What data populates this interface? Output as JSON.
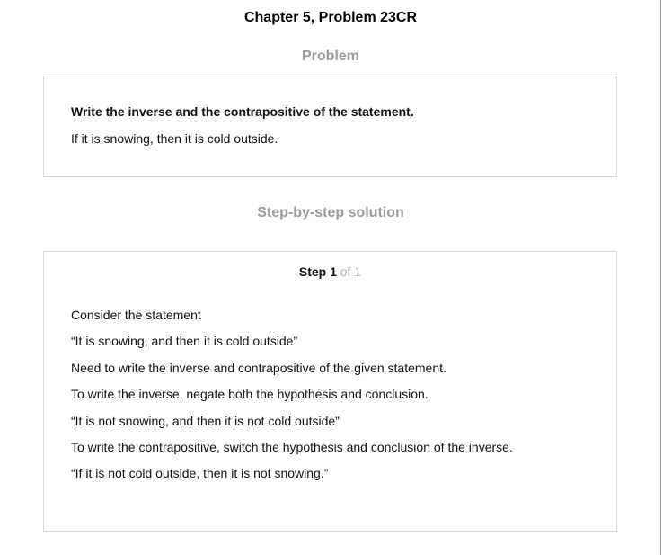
{
  "header": {
    "title": "Chapter 5, Problem 23CR"
  },
  "problem": {
    "heading": "Problem",
    "prompt": "Write the inverse and the contrapositive of the statement.",
    "statement": "If it is snowing, then it is cold outside."
  },
  "solution": {
    "heading": "Step-by-step solution",
    "step": {
      "label": "Step 1",
      "of": "of 1"
    },
    "lines": [
      "Consider the statement",
      "“It is snowing, and then it is cold outside”",
      "Need to write the inverse and contrapositive of the given statement.",
      "To write the inverse, negate both the hypothesis and conclusion.",
      "“It is not snowing, and then it is not cold outside”",
      "To write the contrapositive, switch the hypothesis and conclusion of the inverse.",
      "“If it is not cold outside, then it is not snowing.”"
    ]
  }
}
